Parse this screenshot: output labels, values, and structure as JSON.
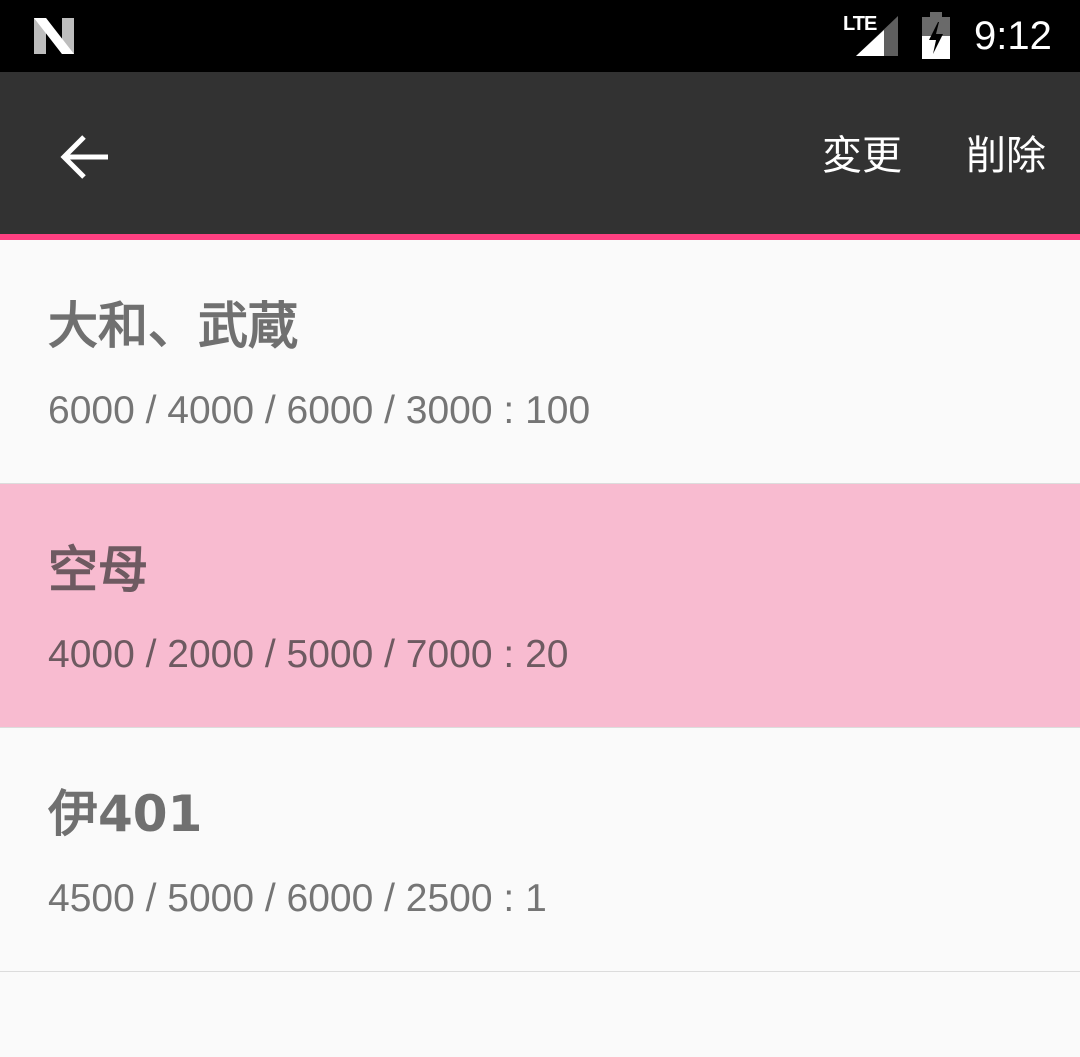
{
  "status_bar": {
    "network_label": "LTE",
    "time": "9:12",
    "icons": [
      "n-logo-icon",
      "signal-icon",
      "battery-charging-icon"
    ]
  },
  "toolbar": {
    "back_icon": "arrow-back-icon",
    "edit_label": "変更",
    "delete_label": "削除"
  },
  "colors": {
    "status_bar_bg": "#000000",
    "toolbar_bg": "#323232",
    "accent": "#ff4081",
    "selected_row_bg": "#f8bbd0",
    "list_bg": "#fafafa",
    "text_gray": "#757575"
  },
  "list": {
    "items": [
      {
        "title": "大和、武蔵",
        "stats": "6000 / 4000 / 6000 / 3000 : 100",
        "selected": false
      },
      {
        "title": "空母",
        "stats": "4000 / 2000 / 5000 / 7000 : 20",
        "selected": true
      },
      {
        "title": "伊401",
        "stats": "4500 / 5000 / 6000 / 2500 : 1",
        "selected": false
      }
    ]
  }
}
